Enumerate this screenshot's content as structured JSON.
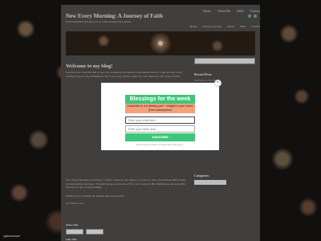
{
  "site": {
    "title": "New Every Morning: A Journey of Faith",
    "tagline": "Encouragement and hope as we walk through life together",
    "top_nav": [
      "Home",
      "About Me",
      "Faith",
      "Contact"
    ],
    "main_nav": [
      "Home",
      "Follow on Social",
      "About",
      "Faith",
      "Contact"
    ]
  },
  "post": {
    "title": "Welcome to my blog!",
    "intro": "It is the Lord's mercies that we are not consumed, because his compassions fail not. They are new every morning: great is thy faithfulness. The Lord is my portion, saith my soul; therefore will I hope in him.",
    "body": "New Every Morning: A Journey of Faith, written by the author, is a place to share devotionals, Bible study, encouragement and hope. Through the ups and downs of life, we can rest in His faithfulness, knowing His mercies are new every morning.",
    "line1": "Thank you for visiting. Be blessed and encouraged!",
    "line2": "In Christ's love,",
    "share_label": "Share this:",
    "like_label": "Like this:"
  },
  "sidebar": {
    "recent_posts_heading": "Recent Posts",
    "recent_posts": [
      "Welcome to my blog!"
    ],
    "categories_heading": "Categories"
  },
  "badge": "optinmonster",
  "popup": {
    "close_glyph": "×",
    "title": "Blessings for the week ahead!",
    "subtitle": "Subscribe to our weekly post + straight to your inbox! (Free subscription)",
    "email_placeholder": "Enter your email here...",
    "name_placeholder": "Enter your name here...",
    "subscribe_label": "SUBSCRIBE",
    "fineprint": "We do not sell or share your information with anyone.",
    "colors": {
      "accent": "#3ec67a",
      "subtitle_bg": "#f5a07a"
    }
  }
}
